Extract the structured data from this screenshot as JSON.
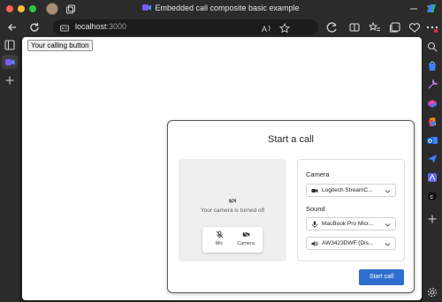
{
  "browser": {
    "window_title": "Embedded call composite basic example",
    "url_host": "localhost",
    "url_port": ":3000"
  },
  "page": {
    "calling_button_label": "Your calling button"
  },
  "call_composite": {
    "title": "Start a call",
    "preview": {
      "camera_off_text": "Your camera is turned off",
      "mic_label": "Mic",
      "camera_label": "Camera"
    },
    "camera_section_label": "Camera",
    "camera_device": "Logitech StreamC...",
    "sound_section_label": "Sound",
    "microphone_device": "MacBook Pro Micr...",
    "speaker_device": "AW3423DWF (Dis...",
    "start_button_label": "Start call"
  },
  "colors": {
    "accent": "#2f6fcf",
    "browser_chrome": "#2b2b2b"
  }
}
